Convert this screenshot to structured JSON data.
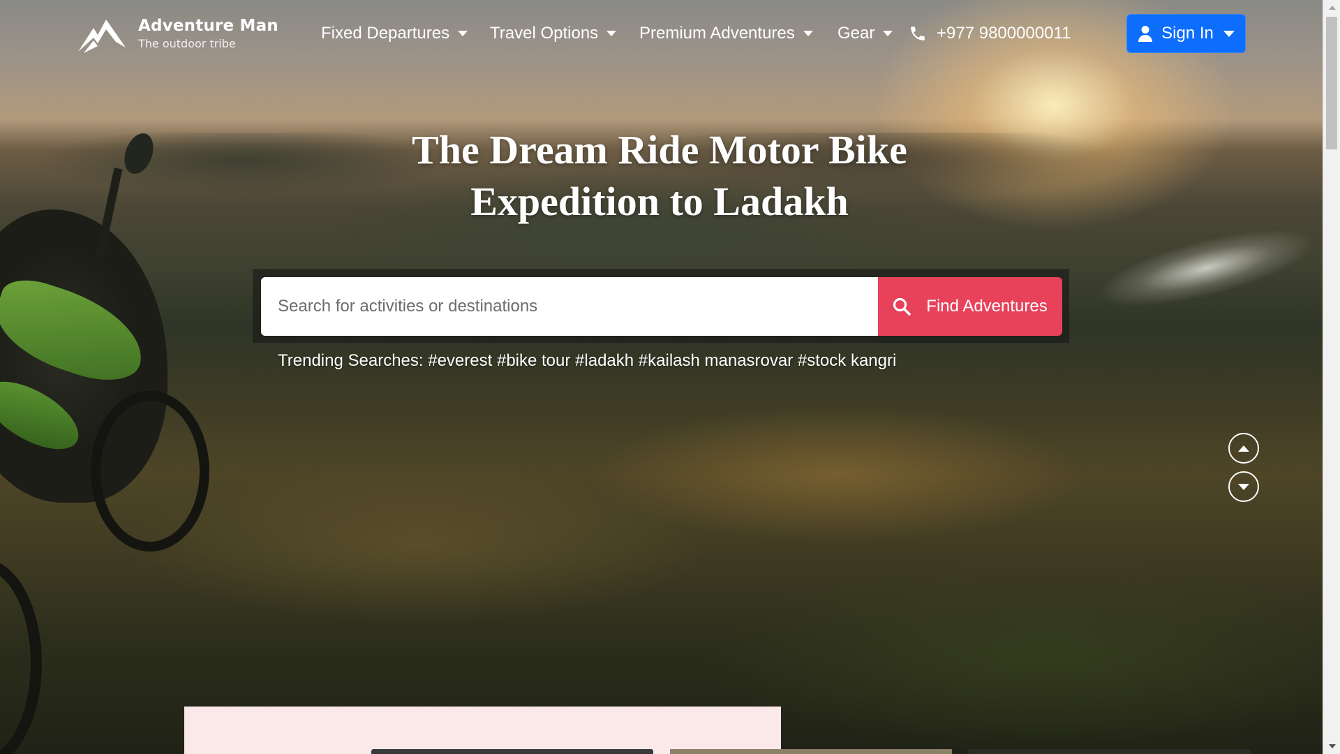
{
  "brand": {
    "name": "Adventure Man",
    "tagline": "The outdoor tribe"
  },
  "nav": {
    "items": [
      {
        "label": "Fixed Departures"
      },
      {
        "label": "Travel Options"
      },
      {
        "label": "Premium Adventures"
      },
      {
        "label": "Gear"
      }
    ],
    "phone": "+977 9800000011",
    "signin_label": "Sign In"
  },
  "hero": {
    "title_line1": "The Dream Ride Motor Bike",
    "title_line2": "Expedition to Ladakh"
  },
  "search": {
    "placeholder": "Search for activities or destinations",
    "button_label": "Find Adventures",
    "trending_label": "Trending Searches:",
    "trending_tags": [
      "#everest",
      "#bike tour",
      "#ladakh",
      "#kailash manasrovar",
      "#stock kangri"
    ]
  },
  "colors": {
    "accent_red": "#e8415a",
    "primary_blue": "#0d6efd",
    "card_bg": "#fbe9ea"
  },
  "icons": {
    "logo": "mountain-logo-icon",
    "phone": "phone-icon",
    "user": "user-icon",
    "search": "search-icon",
    "carousel_prev": "chevron-up-icon",
    "carousel_next": "chevron-down-icon"
  }
}
